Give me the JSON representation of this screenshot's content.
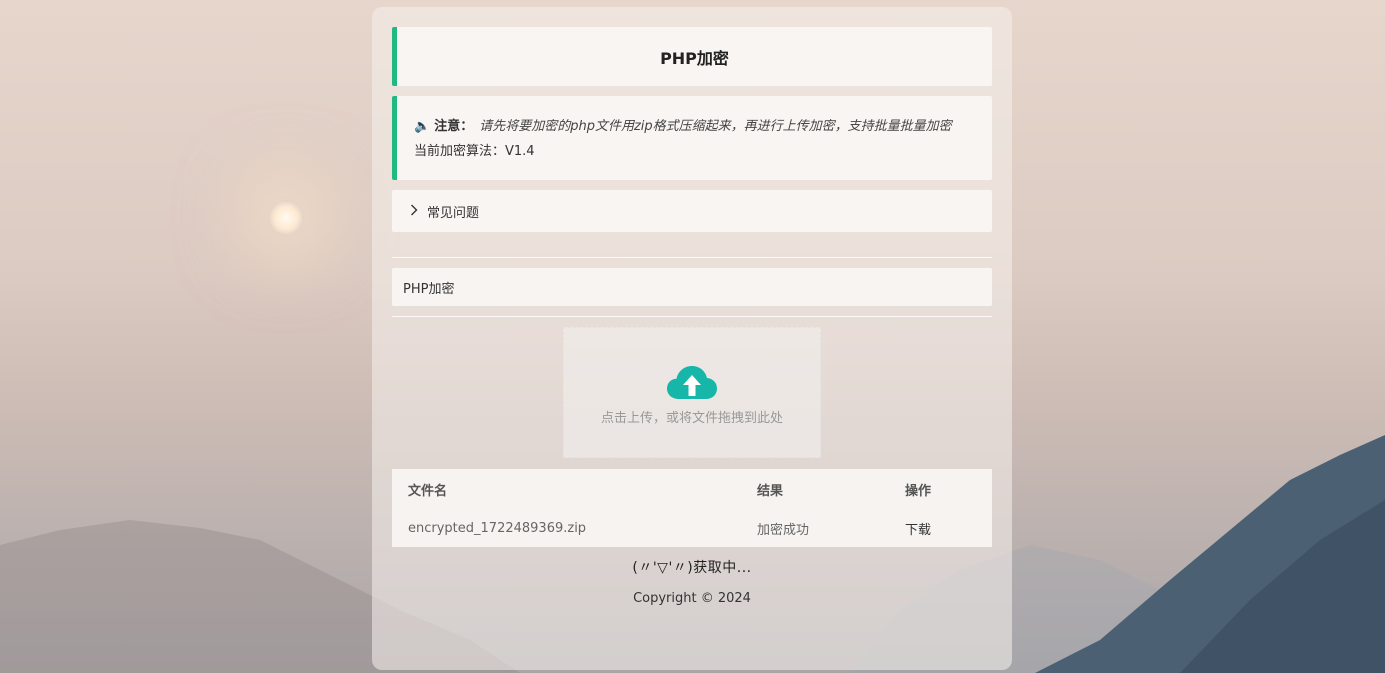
{
  "header": {
    "title": "PHP加密"
  },
  "notice": {
    "label": "注意：",
    "text": "请先将要加密的php文件用zip格式压缩起来，再进行上传加密，支持批量批量加密",
    "algorithm": "当前加密算法：V1.4"
  },
  "faq": {
    "label": "常见问题"
  },
  "section": {
    "label": "PHP加密"
  },
  "upload": {
    "hint": "点击上传，或将文件拖拽到此处"
  },
  "table": {
    "headers": [
      "文件名",
      "结果",
      "操作"
    ],
    "rows": [
      {
        "filename": "encrypted_1722489369.zip",
        "result": "加密成功",
        "action": "下载"
      }
    ]
  },
  "status": "(〃'▽'〃)获取中...",
  "footer": "Copyright © 2024",
  "colors": {
    "accent": "#1fb981",
    "upload_icon": "#16b7a8"
  }
}
